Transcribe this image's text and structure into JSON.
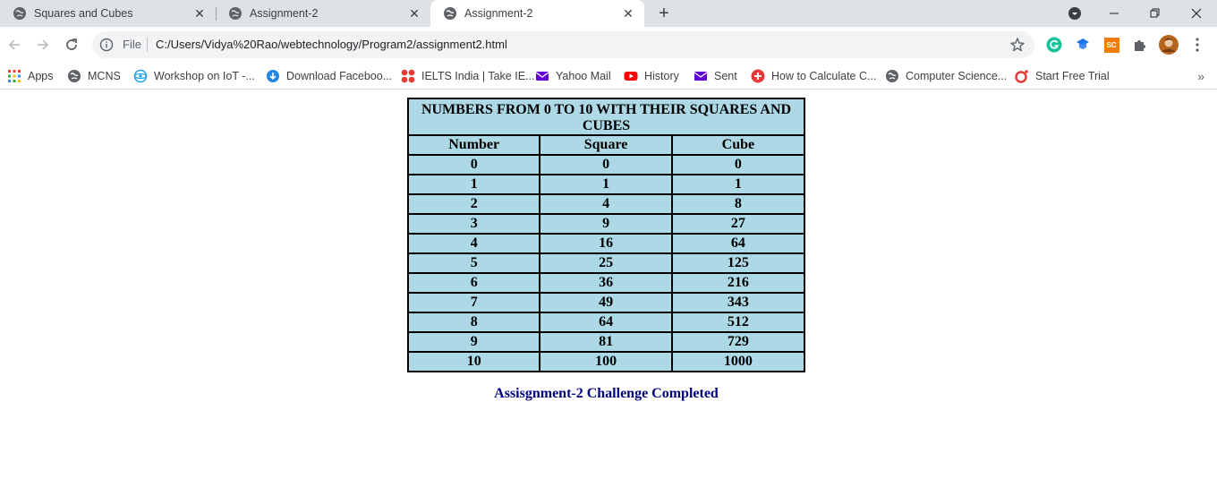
{
  "browser": {
    "tabs": [
      {
        "title": "Squares and Cubes",
        "icon": "globe-icon",
        "active": false
      },
      {
        "title": "Assignment-2",
        "icon": "globe-icon",
        "active": false
      },
      {
        "title": "Assignment-2",
        "icon": "globe-icon",
        "active": true
      }
    ],
    "address": {
      "scheme_label": "File",
      "url": "C:/Users/Vidya%20Rao/webtechnology/Program2/assignment2.html"
    },
    "extensions": [
      "grammarly-icon",
      "extension-blue-icon",
      "sc-extension-icon",
      "puzzle-icon",
      "profile-avatar"
    ],
    "extension_badges": {
      "sc": "SC"
    },
    "bookmarks": [
      {
        "label": "Apps",
        "icon": "apps-grid-icon",
        "color": "#ea4335"
      },
      {
        "label": "MCNS",
        "icon": "globe-icon",
        "color": "#5f6368"
      },
      {
        "label": "Workshop on IoT -...",
        "icon": "workshop-icon",
        "color": "#1aa3e8"
      },
      {
        "label": "Download Faceboo...",
        "icon": "download-icon",
        "color": "#1e88e5"
      },
      {
        "label": "IELTS India | Take IE...",
        "icon": "ielts-icon",
        "color": "#e53935"
      },
      {
        "label": "Yahoo Mail",
        "icon": "mail-icon",
        "color": "#6001d2"
      },
      {
        "label": "History",
        "icon": "youtube-icon",
        "color": "#ff0000"
      },
      {
        "label": "Sent",
        "icon": "mail-icon",
        "color": "#6001d2"
      },
      {
        "label": "How to Calculate C...",
        "icon": "plus-circle-icon",
        "color": "#e53935"
      },
      {
        "label": "Computer Science...",
        "icon": "globe-icon",
        "color": "#5f6368"
      },
      {
        "label": "Start Free Trial",
        "icon": "opera-icon",
        "color": "#e53935"
      }
    ]
  },
  "page": {
    "table": {
      "caption": "NUMBERS FROM 0 TO 10 WITH THEIR SQUARES AND CUBES",
      "headers": [
        "Number",
        "Square",
        "Cube"
      ],
      "rows": [
        [
          "0",
          "0",
          "0"
        ],
        [
          "1",
          "1",
          "1"
        ],
        [
          "2",
          "4",
          "8"
        ],
        [
          "3",
          "9",
          "27"
        ],
        [
          "4",
          "16",
          "64"
        ],
        [
          "5",
          "25",
          "125"
        ],
        [
          "6",
          "36",
          "216"
        ],
        [
          "7",
          "49",
          "343"
        ],
        [
          "8",
          "64",
          "512"
        ],
        [
          "9",
          "81",
          "729"
        ],
        [
          "10",
          "100",
          "1000"
        ]
      ],
      "background_color": "#add8e6"
    },
    "footer": "Assisgnment-2 Challenge Completed",
    "footer_color": "#000080"
  }
}
